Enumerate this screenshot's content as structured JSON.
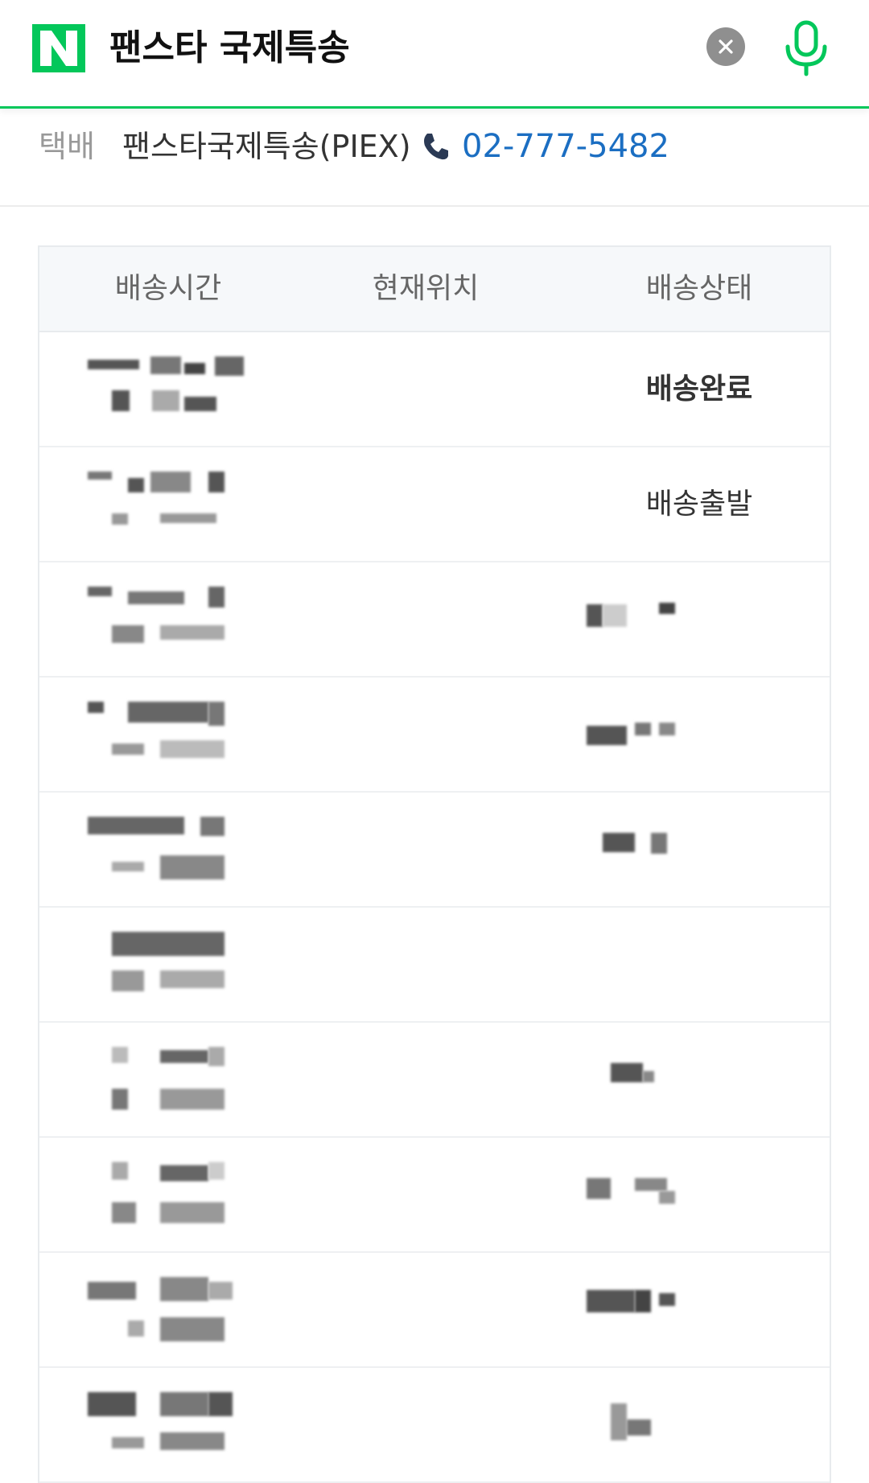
{
  "search": {
    "query": "팬스타 국제특송",
    "clear_icon": "close-icon",
    "mic_icon": "microphone-icon"
  },
  "brand": {
    "logo_letter": "N",
    "accent_color": "#03c75a"
  },
  "courier": {
    "category": "택배",
    "name": "팬스타국제특송(PIEX)",
    "phone": "02-777-5482",
    "phone_color": "#1b6ec2"
  },
  "table": {
    "headers": [
      "배송시간",
      "현재위치",
      "배송상태"
    ],
    "rows": [
      {
        "time": "",
        "location": "",
        "status": "배송완료",
        "status_bold": true
      },
      {
        "time": "",
        "location": "",
        "status": "배송출발",
        "status_bold": false
      },
      {
        "time": "",
        "location": "",
        "status": "",
        "status_bold": false
      },
      {
        "time": "",
        "location": "",
        "status": "",
        "status_bold": false
      },
      {
        "time": "",
        "location": "",
        "status": "",
        "status_bold": false
      },
      {
        "time": "",
        "location": "",
        "status": "",
        "status_bold": false
      },
      {
        "time": "",
        "location": "",
        "status": "",
        "status_bold": false
      },
      {
        "time": "",
        "location": "",
        "status": "",
        "status_bold": false
      },
      {
        "time": "",
        "location": "",
        "status": "",
        "status_bold": false
      },
      {
        "time": "",
        "location": "",
        "status": "",
        "status_bold": false
      }
    ]
  }
}
